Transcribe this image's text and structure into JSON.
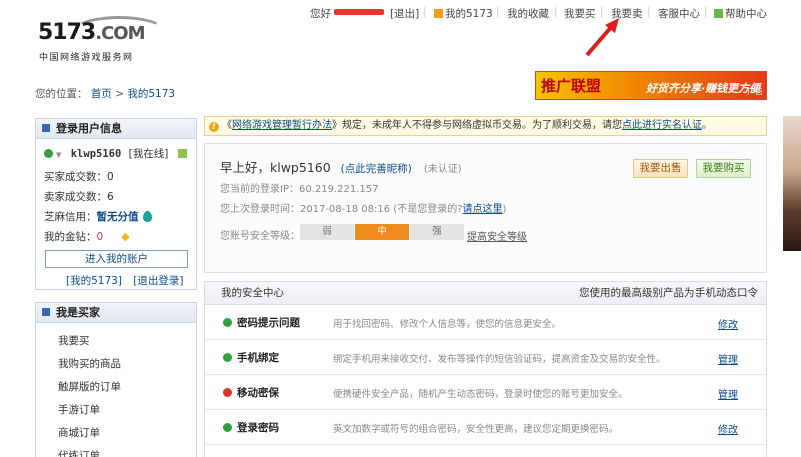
{
  "topnav": {
    "greeting": "您好",
    "logout": "[退出]",
    "my5173": "我的5173",
    "favorites": "我的收藏",
    "buy": "我要买",
    "sell": "我要卖",
    "service": "客服中心",
    "help": "帮助中心"
  },
  "logo": {
    "main": "5173",
    "com": ".COM",
    "sub": "中国网络游戏服务网"
  },
  "banner": {
    "text_a": "推广联盟",
    "text_b": "好货齐分享·赚钱更方便",
    "ad": "广告"
  },
  "breadcrumb": {
    "prefix": "您的位置：",
    "home": "首页",
    "sep": ">",
    "current": "我的5173"
  },
  "login_panel": {
    "title": "登录用户信息",
    "username": "klwp5160",
    "online": "[我在线]",
    "buyer_deals_label": "买家成交数：",
    "buyer_deals_value": "0",
    "seller_deals_label": "卖家成交数：",
    "seller_deals_value": "6",
    "sesame_label": "芝麻信用：",
    "sesame_value": "暂无分值",
    "gold_label": "我的金钻：",
    "gold_value": "0",
    "enter_account": "进入我的账户",
    "link_my5173": "[我的5173]",
    "link_logout": "[退出登录]"
  },
  "buyer_panel": {
    "title": "我是买家",
    "items": [
      "我要买",
      "我购买的商品",
      "触屏版的订单",
      "手游订单",
      "商城订单",
      "代练订单"
    ]
  },
  "notice": {
    "pre": "《",
    "link": "网络游戏管理暂行办法",
    "mid": "》规定，未成年人不得参与网络虚拟币交易。为了顺利交易，请您",
    "link2": "点此进行实名认证",
    "post": "。"
  },
  "greeting_box": {
    "hello": "早上好，klwp5160",
    "complete_link": "(点此完善昵称)",
    "unverified": "(未认证)",
    "ip_label": "您当前的登录IP：60.219.221.157",
    "last_login": "您上次登录时间：2017-08-18 08:16 (不是您登录的?",
    "click_here": "请点这里",
    "close_paren": ")",
    "security_label": "您账号安全等级：",
    "levels": [
      "弱",
      "中",
      "强"
    ],
    "improve_link": "提高安全等级",
    "btn_sell": "我要出售",
    "btn_buy": "我要购买"
  },
  "security_center": {
    "title": "我的安全中心",
    "highest_label": "您使用的最高级别产品为：",
    "highest_value": "手机动态口令",
    "rows": [
      {
        "name": "密码提示问题",
        "desc": "用于找回密码、修改个人信息等，使您的信息更安全。",
        "action": "修改",
        "status": "ok"
      },
      {
        "name": "手机绑定",
        "desc": "绑定手机用来接收交付、发布等操作的短信验证码，提高资金及交易的安全性。",
        "action": "管理",
        "status": "ok"
      },
      {
        "name": "移动密保",
        "desc": "便携硬件安全产品，随机产生动态密码，登录时使您的账号更加安全。",
        "action": "管理",
        "status": "bad"
      },
      {
        "name": "登录密码",
        "desc": "英文加数字或符号的组合密码，安全性更高，建议您定期更换密码。",
        "action": "修改",
        "status": "ok"
      }
    ]
  },
  "colors": {
    "ok": "#31a13b",
    "bad": "#d9362b",
    "accent": "#ee8b1c",
    "link": "#0b4c8a",
    "arrow": "#e0191b"
  }
}
